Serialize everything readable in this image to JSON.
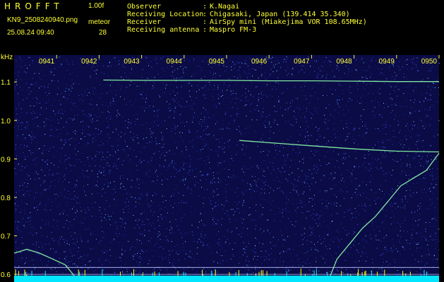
{
  "header": {
    "app_name": "HROFFT",
    "version": "1.00f",
    "filename": "KN9_2508240940.png",
    "datetime": "25.08.24 09:40",
    "meteor_label": "meteor",
    "meteor_count": "28",
    "info": [
      {
        "key": "Observer",
        "value": "K.Nagai"
      },
      {
        "key": "Receiving Location",
        "value": "Chigasaki, Japan (139.414 35.340)"
      },
      {
        "key": "Receiver",
        "value": "AirSpy mini (Miakejima VOR 108.65MHz)"
      },
      {
        "key": "Receiving antenna",
        "value": "Maspro FM-3"
      }
    ],
    "colon": ":"
  },
  "colors": {
    "text": "#ffff33",
    "background": "#0b0b46",
    "trace": "#7fe8a0",
    "baseline": "#00e6ff",
    "spikes": "#ffff00"
  },
  "chart_data": {
    "type": "heatmap",
    "title": "",
    "ylabel": "kHz",
    "xlabel": "",
    "x_ticks": [
      "0941",
      "0942",
      "0943",
      "0944",
      "0945",
      "0946",
      "0947",
      "0948",
      "0949",
      "0950"
    ],
    "y_ticks": [
      "1.1",
      "1.0",
      "0.9",
      "0.8",
      "0.7",
      "0.6"
    ],
    "ylim": [
      0.58,
      1.17
    ],
    "xlim": [
      "09:40",
      "09:50"
    ],
    "grid": false,
    "series": [
      {
        "x": [
          2.1,
          3.0,
          4.0,
          5.0,
          6.0,
          7.0,
          8.0,
          9.0,
          10.0
        ],
        "y": [
          1.105,
          1.104,
          1.104,
          1.104,
          1.103,
          1.103,
          1.102,
          1.101,
          1.101
        ]
      },
      {
        "x": [
          5.3,
          6.0,
          7.0,
          8.0,
          9.0,
          10.0
        ],
        "y": [
          0.948,
          0.942,
          0.934,
          0.926,
          0.92,
          0.918
        ]
      },
      {
        "x": [
          0.0,
          0.3,
          0.6,
          0.9,
          1.2,
          1.5
        ],
        "y": [
          0.655,
          0.665,
          0.655,
          0.64,
          0.625,
          0.585
        ]
      },
      {
        "x": [
          7.4,
          7.6,
          7.9,
          8.2,
          8.5,
          8.8,
          9.1,
          9.4,
          9.7,
          10.0
        ],
        "y": [
          0.585,
          0.64,
          0.68,
          0.72,
          0.75,
          0.79,
          0.83,
          0.85,
          0.87,
          0.915
        ]
      }
    ]
  }
}
